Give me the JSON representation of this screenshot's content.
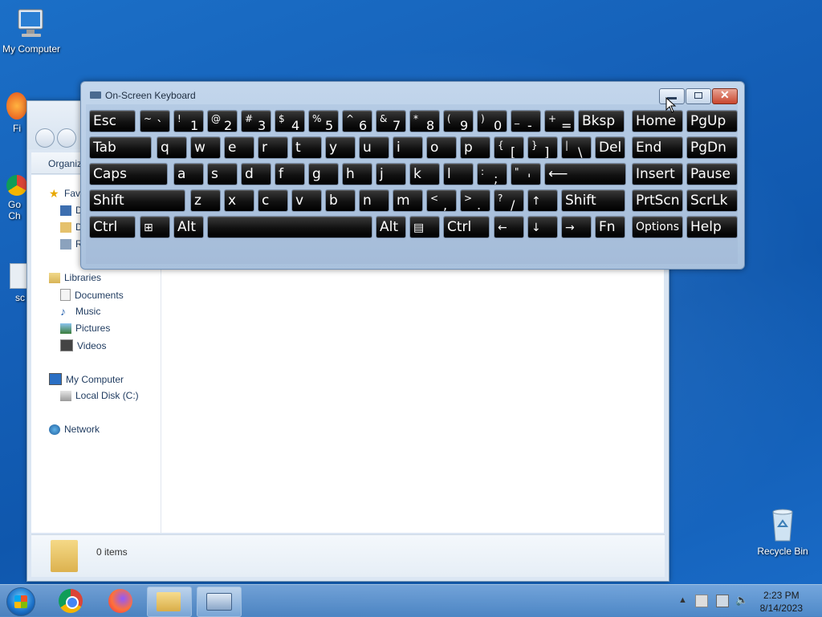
{
  "desktop": {
    "icons": [
      {
        "label": "My Computer"
      },
      {
        "label": "Fi"
      },
      {
        "label": "Go Ch"
      },
      {
        "label": "sc"
      },
      {
        "label": "Recycle Bin"
      }
    ]
  },
  "explorer": {
    "toolbar": {
      "organize": "Organiz"
    },
    "nav": {
      "favorites": "Fav",
      "fav_items": [
        "D",
        "D",
        "R"
      ],
      "libraries": "Libraries",
      "lib_items": [
        "Documents",
        "Music",
        "Pictures",
        "Videos"
      ],
      "computer": "My Computer",
      "computer_items": [
        "Local Disk (C:)"
      ],
      "network": "Network"
    },
    "status": {
      "items": "0 items"
    }
  },
  "osk": {
    "title": "On-Screen Keyboard",
    "rows": [
      [
        {
          "label": "Esc"
        },
        {
          "sub": "~",
          "main": "`"
        },
        {
          "sub": "!",
          "main": "1"
        },
        {
          "sub": "@",
          "main": "2"
        },
        {
          "sub": "#",
          "main": "3"
        },
        {
          "sub": "$",
          "main": "4"
        },
        {
          "sub": "%",
          "main": "5"
        },
        {
          "sub": "^",
          "main": "6"
        },
        {
          "sub": "&",
          "main": "7"
        },
        {
          "sub": "*",
          "main": "8"
        },
        {
          "sub": "(",
          "main": "9"
        },
        {
          "sub": ")",
          "main": "0"
        },
        {
          "sub": "_",
          "main": "-"
        },
        {
          "sub": "+",
          "main": "="
        },
        {
          "label": "Bksp"
        }
      ],
      [
        {
          "label": "Tab"
        },
        {
          "label": "q"
        },
        {
          "label": "w"
        },
        {
          "label": "e"
        },
        {
          "label": "r"
        },
        {
          "label": "t"
        },
        {
          "label": "y"
        },
        {
          "label": "u"
        },
        {
          "label": "i"
        },
        {
          "label": "o"
        },
        {
          "label": "p"
        },
        {
          "sub": "{",
          "main": "["
        },
        {
          "sub": "}",
          "main": "]"
        },
        {
          "sub": "|",
          "main": "\\"
        },
        {
          "label": "Del"
        }
      ],
      [
        {
          "label": "Caps"
        },
        {
          "label": "a"
        },
        {
          "label": "s"
        },
        {
          "label": "d"
        },
        {
          "label": "f"
        },
        {
          "label": "g"
        },
        {
          "label": "h"
        },
        {
          "label": "j"
        },
        {
          "label": "k"
        },
        {
          "label": "l"
        },
        {
          "sub": ":",
          "main": ";"
        },
        {
          "sub": "\"",
          "main": "'"
        },
        {
          "label": "⟵"
        }
      ],
      [
        {
          "label": "Shift"
        },
        {
          "label": "z"
        },
        {
          "label": "x"
        },
        {
          "label": "c"
        },
        {
          "label": "v"
        },
        {
          "label": "b"
        },
        {
          "label": "n"
        },
        {
          "label": "m"
        },
        {
          "sub": "<",
          "main": ","
        },
        {
          "sub": ">",
          "main": "."
        },
        {
          "sub": "?",
          "main": "/"
        },
        {
          "label": "↑"
        },
        {
          "label": "Shift"
        }
      ],
      [
        {
          "label": "Ctrl"
        },
        {
          "label": "⊞"
        },
        {
          "label": "Alt"
        },
        {
          "label": ""
        },
        {
          "label": "Alt"
        },
        {
          "label": "▤"
        },
        {
          "label": "Ctrl"
        },
        {
          "label": "←"
        },
        {
          "label": "↓"
        },
        {
          "label": "→"
        },
        {
          "label": "Fn"
        }
      ]
    ],
    "nav_keys": [
      [
        "Home",
        "PgUp"
      ],
      [
        "End",
        "PgDn"
      ],
      [
        "Insert",
        "Pause"
      ],
      [
        "PrtScn",
        "ScrLk"
      ],
      [
        "Options",
        "Help"
      ]
    ]
  },
  "taskbar": {
    "clock_time": "2:23 PM",
    "clock_date": "8/14/2023"
  }
}
